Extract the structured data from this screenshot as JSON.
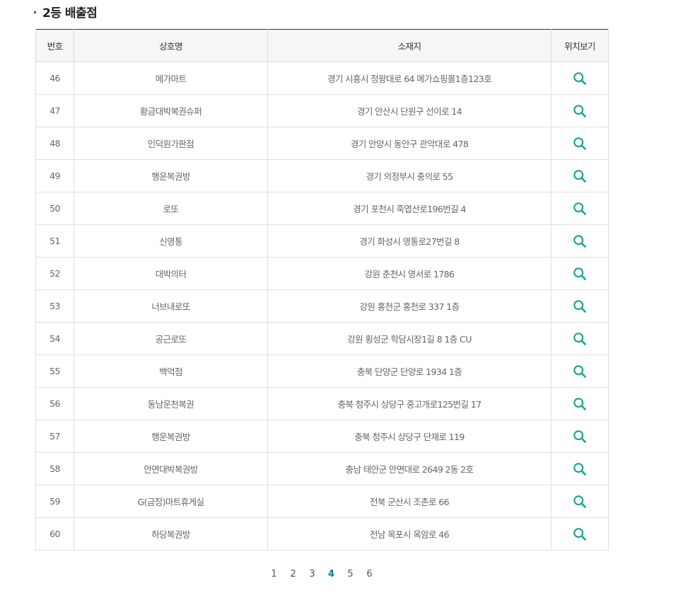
{
  "section": {
    "title": "2등 배출점"
  },
  "table": {
    "headers": [
      "번호",
      "상호명",
      "소재지",
      "위치보기"
    ],
    "rows": [
      {
        "no": "46",
        "name": "메가마트",
        "address": "경기 시흥시 정왕대로 64 메가쇼핑몰1층123호"
      },
      {
        "no": "47",
        "name": "황금대박복권슈퍼",
        "address": "경기 안산시 단원구 선이로 14"
      },
      {
        "no": "48",
        "name": "인덕원가판점",
        "address": "경기 안양시 동안구 관악대로 478"
      },
      {
        "no": "49",
        "name": "행운복권방",
        "address": "경기 의정부시 충의로 55"
      },
      {
        "no": "50",
        "name": "로또",
        "address": "경기 포천시 죽엽산로196번길 4"
      },
      {
        "no": "51",
        "name": "신영통",
        "address": "경기 화성시 영통로27번길 8"
      },
      {
        "no": "52",
        "name": "대박의터",
        "address": "강원 춘천시 영서로 1786"
      },
      {
        "no": "53",
        "name": "너브내로또",
        "address": "강원 홍천군 홍천로 337 1층"
      },
      {
        "no": "54",
        "name": "공근로또",
        "address": "강원 횡성군 학담시장1길 8 1층 CU"
      },
      {
        "no": "55",
        "name": "백억점",
        "address": "충북 단양군 단양로 1934 1층"
      },
      {
        "no": "56",
        "name": "동남운천복권",
        "address": "충북 청주시 상당구 중고개로125번길 17"
      },
      {
        "no": "57",
        "name": "행운복권방",
        "address": "충북 청주시 상당구 단재로 119"
      },
      {
        "no": "58",
        "name": "안면대박복권방",
        "address": "충남 태안군 안면대로 2649 2동 2호"
      },
      {
        "no": "59",
        "name": "G(금정)마트휴게실",
        "address": "전북 군산시 조촌로 66"
      },
      {
        "no": "60",
        "name": "하당복권방",
        "address": "전남 목포시 옥암로 46"
      }
    ]
  },
  "pagination": {
    "pages": [
      "1",
      "2",
      "3",
      "4",
      "5",
      "6"
    ],
    "current": "4"
  },
  "icons": {
    "location": "search-icon"
  },
  "colors": {
    "accent": "#13768f",
    "icon": "#1ba39c",
    "header_bg": "#f6f6f6",
    "header_top_border": "#333333"
  }
}
